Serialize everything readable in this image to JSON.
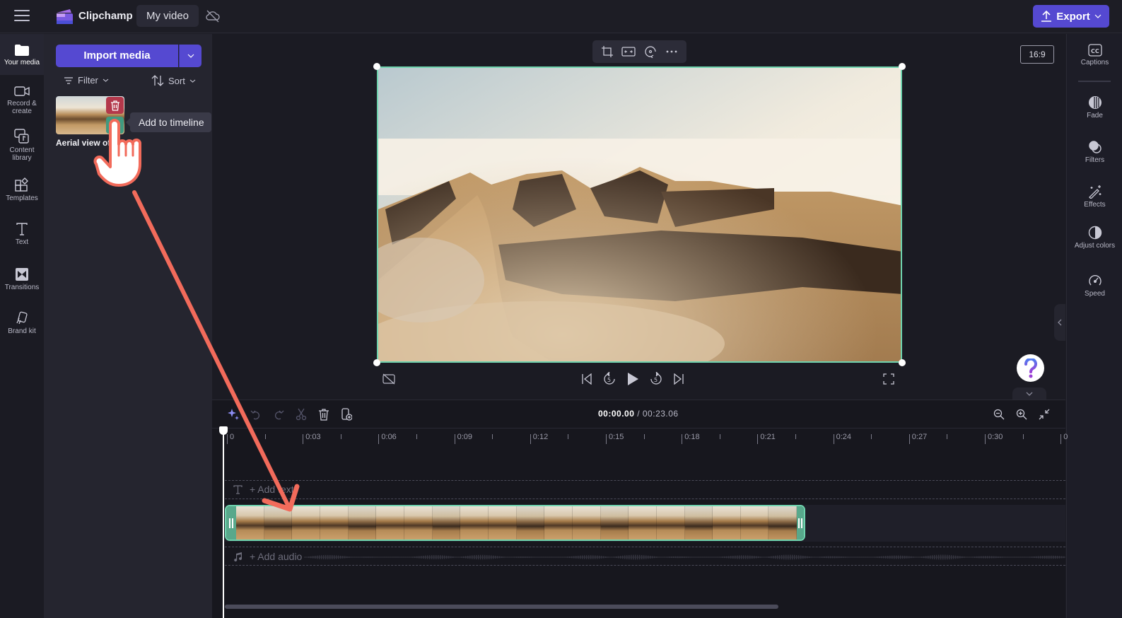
{
  "topbar": {
    "app_name": "Clipchamp",
    "project_name": "My video",
    "export_label": "Export"
  },
  "left_rail": {
    "items": [
      {
        "label": "Your media",
        "icon": "folder-icon",
        "active": true
      },
      {
        "label": "Record & create",
        "icon": "video-camera-icon"
      },
      {
        "label": "Content library",
        "icon": "content-library-icon"
      },
      {
        "label": "Templates",
        "icon": "templates-icon"
      },
      {
        "label": "Text",
        "icon": "text-icon"
      },
      {
        "label": "Transitions",
        "icon": "transitions-icon"
      },
      {
        "label": "Brand kit",
        "icon": "brand-kit-icon"
      }
    ]
  },
  "media_panel": {
    "import_label": "Import media",
    "filter_label": "Filter",
    "sort_label": "Sort",
    "media_items": [
      {
        "title": "Aerial view of..."
      }
    ],
    "tooltip": "Add to timeline"
  },
  "preview": {
    "aspect_ratio": "16:9",
    "toolbar_icons": [
      "crop-icon",
      "fit-icon",
      "rotate-icon",
      "more-icon"
    ]
  },
  "right_rail": {
    "items": [
      {
        "label": "Captions",
        "icon": "captions-icon"
      },
      {
        "label": "Fade",
        "icon": "fade-icon"
      },
      {
        "label": "Filters",
        "icon": "filters-icon"
      },
      {
        "label": "Effects",
        "icon": "effects-icon"
      },
      {
        "label": "Adjust colors",
        "icon": "adjust-colors-icon"
      },
      {
        "label": "Speed",
        "icon": "speed-icon"
      }
    ]
  },
  "timeline": {
    "current_time": "00:00.00",
    "total_time": "/ 00:23.06",
    "ruler_labels": [
      "0",
      "0:03",
      "0:06",
      "0:09",
      "0:12",
      "0:15",
      "0:18",
      "0:21",
      "0:24",
      "0:27",
      "0:30",
      "0"
    ],
    "add_text_label": "+ Add text",
    "add_audio_label": "+ Add audio"
  },
  "colors": {
    "accent": "#5549d1",
    "clip_border": "#6fd3ae",
    "delete": "#b3384b",
    "add": "#3f9a80",
    "annotation": "#f26b5b"
  }
}
